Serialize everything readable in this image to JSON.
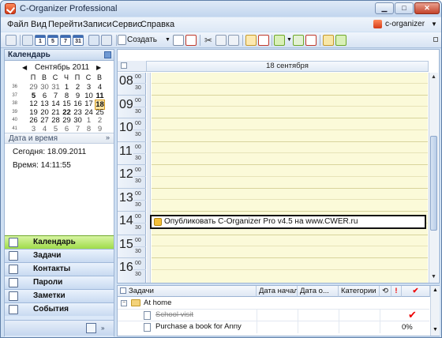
{
  "window": {
    "title": "C-Organizer Professional"
  },
  "menu": {
    "items": [
      "Файл",
      "Вид",
      "Перейти",
      "Записи",
      "Сервис",
      "Справка"
    ],
    "profile": "c-organizer"
  },
  "toolbar": {
    "create_label": "Создать",
    "view_icons": [
      {
        "name": "day-view-icon",
        "text": "1"
      },
      {
        "name": "work-week-view-icon",
        "text": "5"
      },
      {
        "name": "week-view-icon",
        "text": "7"
      },
      {
        "name": "month-view-icon",
        "text": "31"
      }
    ]
  },
  "calendar_pane": {
    "title": "Календарь",
    "month_label": "Сентябрь 2011",
    "weekday_headers": [
      "П",
      "В",
      "С",
      "Ч",
      "П",
      "С",
      "В"
    ],
    "week_numbers": [
      "36",
      "37",
      "38",
      "39",
      "40",
      "41"
    ],
    "weeks": [
      [
        {
          "d": "29",
          "o": true
        },
        {
          "d": "30",
          "o": true
        },
        {
          "d": "31",
          "o": true
        },
        {
          "d": "1"
        },
        {
          "d": "2"
        },
        {
          "d": "3"
        },
        {
          "d": "4"
        }
      ],
      [
        {
          "d": "5",
          "b": true
        },
        {
          "d": "6"
        },
        {
          "d": "7"
        },
        {
          "d": "8"
        },
        {
          "d": "9"
        },
        {
          "d": "10"
        },
        {
          "d": "11",
          "b": true
        }
      ],
      [
        {
          "d": "12"
        },
        {
          "d": "13"
        },
        {
          "d": "14"
        },
        {
          "d": "15"
        },
        {
          "d": "16"
        },
        {
          "d": "17"
        },
        {
          "d": "18",
          "t": true
        }
      ],
      [
        {
          "d": "19"
        },
        {
          "d": "20"
        },
        {
          "d": "21"
        },
        {
          "d": "22",
          "b": true
        },
        {
          "d": "23"
        },
        {
          "d": "24"
        },
        {
          "d": "25"
        }
      ],
      [
        {
          "d": "26"
        },
        {
          "d": "27"
        },
        {
          "d": "28"
        },
        {
          "d": "29"
        },
        {
          "d": "30"
        },
        {
          "d": "1",
          "o": true
        },
        {
          "d": "2",
          "o": true
        }
      ],
      [
        {
          "d": "3",
          "o": true
        },
        {
          "d": "4",
          "o": true
        },
        {
          "d": "5",
          "o": true
        },
        {
          "d": "6",
          "o": true
        },
        {
          "d": "7",
          "o": true
        },
        {
          "d": "8",
          "o": true
        },
        {
          "d": "9",
          "o": true
        }
      ]
    ]
  },
  "datetime_pane": {
    "title": "Дата и время",
    "today_label": "Сегодня: 18.09.2011",
    "time_label": "Время: 14:11:55"
  },
  "nav": {
    "items": [
      {
        "label": "Календарь",
        "active": true,
        "icon": "calendar-nav-icon"
      },
      {
        "label": "Задачи",
        "icon": "tasks-nav-icon"
      },
      {
        "label": "Контакты",
        "icon": "contacts-nav-icon"
      },
      {
        "label": "Пароли",
        "icon": "passwords-nav-icon"
      },
      {
        "label": "Заметки",
        "icon": "notes-nav-icon"
      },
      {
        "label": "События",
        "icon": "events-nav-icon"
      }
    ]
  },
  "dayview": {
    "date_header": "18 сентября",
    "hours": [
      "08",
      "09",
      "10",
      "11",
      "12",
      "13",
      "14",
      "15",
      "16"
    ],
    "minute_top": "00",
    "minute_half": "30",
    "event_title": "Опубликовать C-Organizer Pro v4.5 на www.CWER.ru"
  },
  "tasks": {
    "columns": {
      "title": "Задачи",
      "start": "Дата начала",
      "due": "Дата о...",
      "category": "Категории"
    },
    "group": "At home",
    "rows": [
      {
        "title": "School visit",
        "done": true,
        "percent": ""
      },
      {
        "title": "Purchase a book for Anny",
        "done": false,
        "percent": "0%"
      }
    ]
  },
  "colors": {
    "accent": "#9fdc4a",
    "event_border": "#111111",
    "slot_bg": "#fbfad9"
  }
}
